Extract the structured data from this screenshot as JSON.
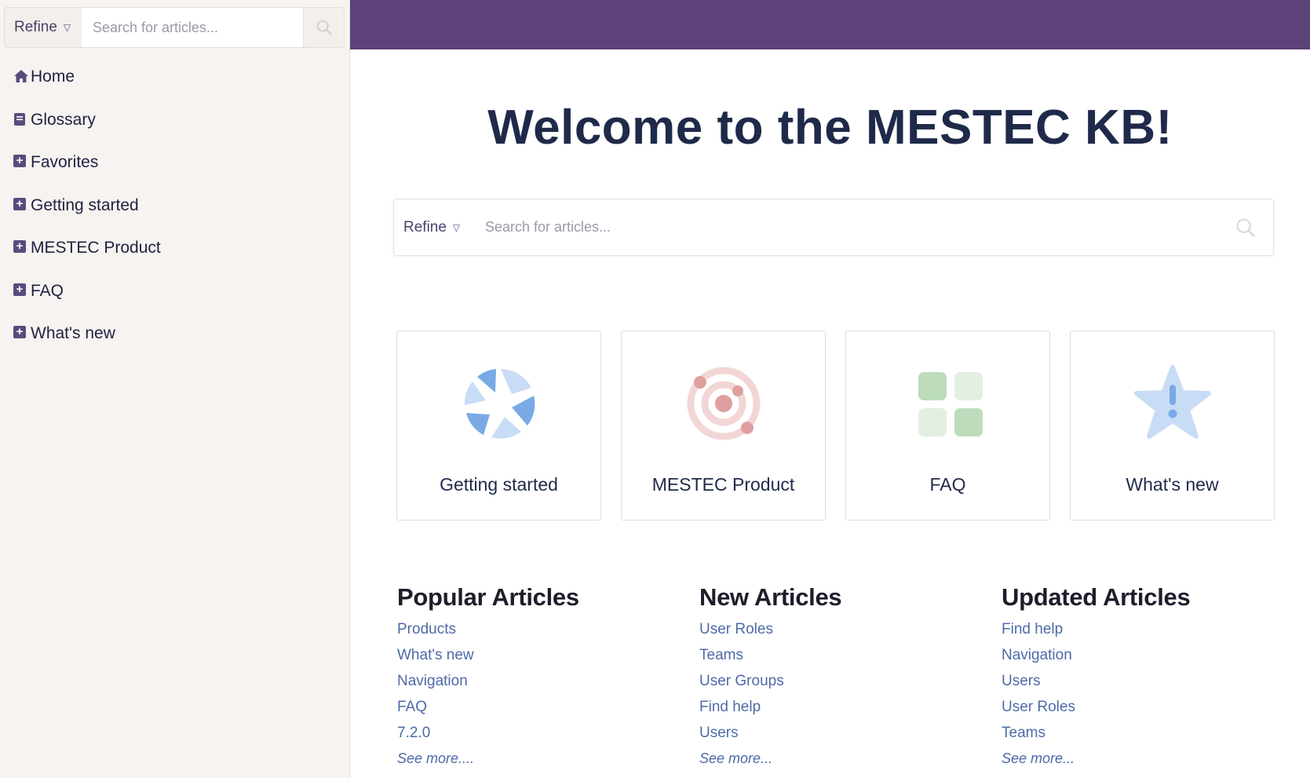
{
  "sidebar": {
    "search": {
      "refine_label": "Refine",
      "placeholder": "Search for articles..."
    },
    "items": [
      {
        "label": "Home",
        "icon": "home-icon"
      },
      {
        "label": "Glossary",
        "icon": "book-icon"
      },
      {
        "label": "Favorites",
        "icon": "plus-square-icon"
      },
      {
        "label": "Getting started",
        "icon": "plus-square-icon"
      },
      {
        "label": "MESTEC Product",
        "icon": "plus-square-icon"
      },
      {
        "label": "FAQ",
        "icon": "plus-square-icon"
      },
      {
        "label": "What's new",
        "icon": "plus-square-icon"
      }
    ]
  },
  "colors": {
    "brand": "#5d427a",
    "heading": "#1f2a4a",
    "link": "#4d6aa8",
    "sidebar_bg": "#f7f3f0"
  },
  "main": {
    "title": "Welcome to the MESTEC KB!",
    "search": {
      "refine_label": "Refine",
      "placeholder": "Search for articles..."
    },
    "cards": [
      {
        "title": "Getting started",
        "icon": "aperture-icon"
      },
      {
        "title": "MESTEC Product",
        "icon": "orbit-icon"
      },
      {
        "title": "FAQ",
        "icon": "grid-icon"
      },
      {
        "title": "What's new",
        "icon": "star-alert-icon"
      }
    ],
    "columns": [
      {
        "heading": "Popular Articles",
        "links": [
          "Products",
          "What's new",
          "Navigation",
          "FAQ",
          "7.2.0"
        ],
        "more": "See more...."
      },
      {
        "heading": "New Articles",
        "links": [
          "User Roles",
          "Teams",
          "User Groups",
          "Find help",
          "Users"
        ],
        "more": "See more..."
      },
      {
        "heading": "Updated Articles",
        "links": [
          "Find help",
          "Navigation",
          "Users",
          "User Roles",
          "Teams"
        ],
        "more": "See more..."
      }
    ]
  }
}
